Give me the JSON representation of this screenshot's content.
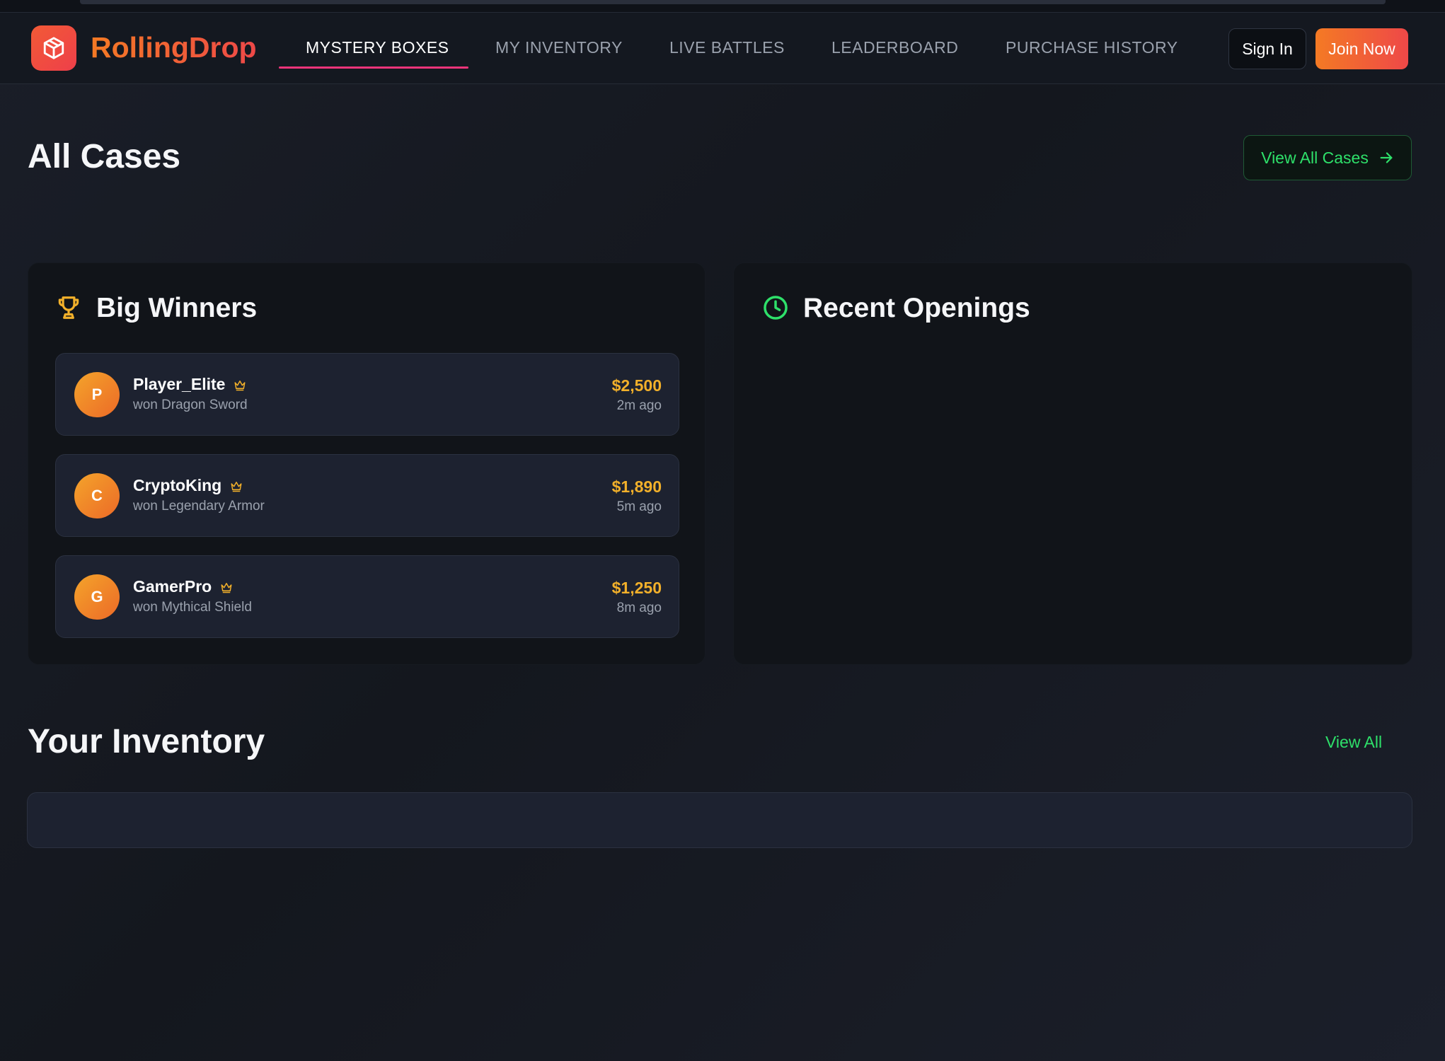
{
  "header": {
    "brand": "RollingDrop",
    "logo_icon": "cube-icon",
    "nav": [
      {
        "label": "MYSTERY BOXES",
        "active": true
      },
      {
        "label": "MY INVENTORY",
        "active": false
      },
      {
        "label": "LIVE BATTLES",
        "active": false
      },
      {
        "label": "LEADERBOARD",
        "active": false
      },
      {
        "label": "PURCHASE HISTORY",
        "active": false
      }
    ],
    "sign_in": "Sign In",
    "join_now": "Join Now"
  },
  "cases": {
    "title": "All Cases",
    "view_all": "View All Cases",
    "view_all_icon": "arrow-right-icon"
  },
  "big_winners": {
    "title": "Big Winners",
    "icon": "trophy-icon",
    "items": [
      {
        "initial": "P",
        "name": "Player_Elite",
        "desc": "won Dragon Sword",
        "amount": "$2,500",
        "time": "2m ago"
      },
      {
        "initial": "C",
        "name": "CryptoKing",
        "desc": "won Legendary Armor",
        "amount": "$1,890",
        "time": "5m ago"
      },
      {
        "initial": "G",
        "name": "GamerPro",
        "desc": "won Mythical Shield",
        "amount": "$1,250",
        "time": "8m ago"
      }
    ]
  },
  "recent_openings": {
    "title": "Recent Openings",
    "icon": "clock-icon"
  },
  "inventory": {
    "title": "Your Inventory",
    "view_all": "View All"
  },
  "colors": {
    "accent_green": "#2ee06a",
    "accent_orange": "#f47a24",
    "accent_red": "#ee4848",
    "gold": "#f2b02a",
    "nav_underline": "#f0347a"
  }
}
